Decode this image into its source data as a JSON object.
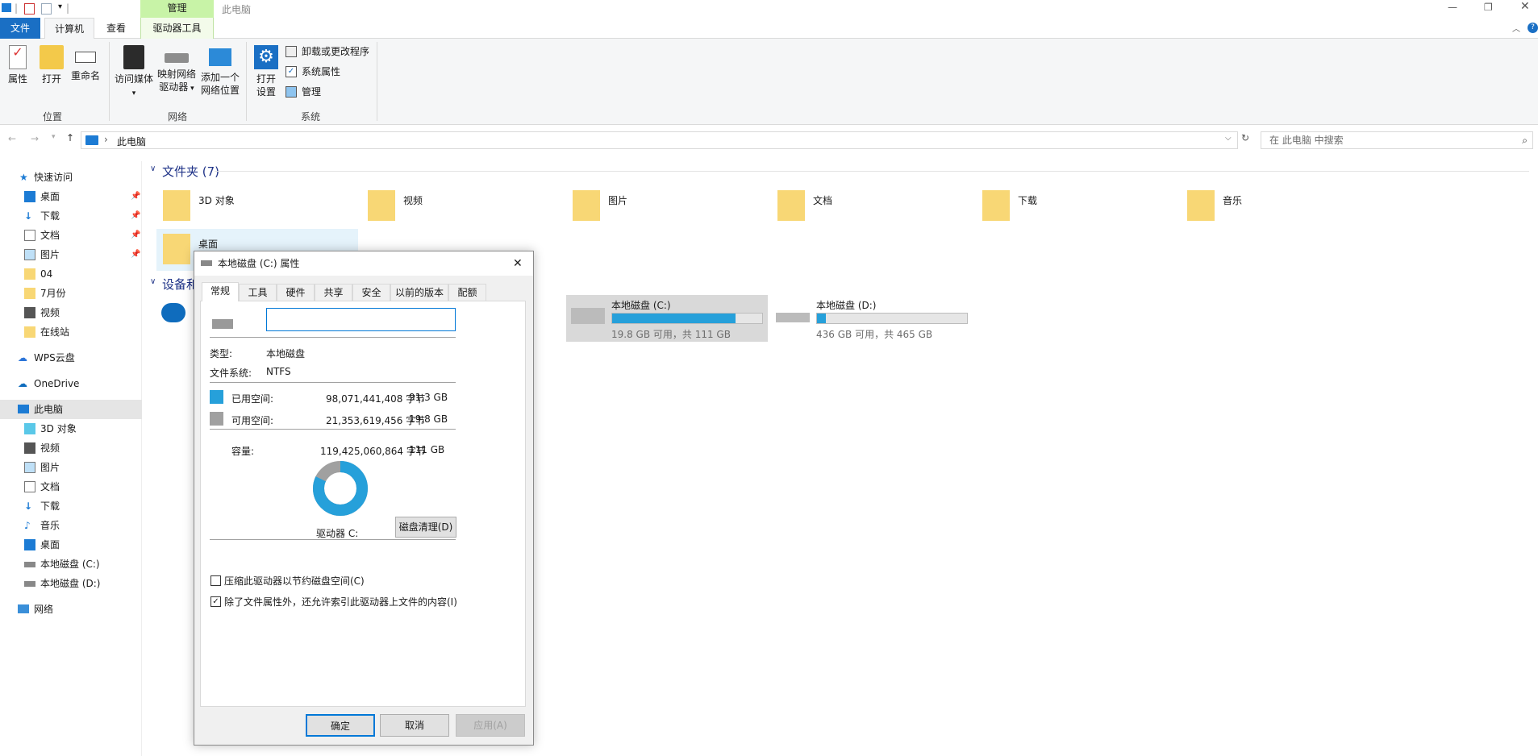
{
  "window": {
    "title": "此电脑",
    "manage_tab": "管理"
  },
  "tabs": [
    "文件",
    "计算机",
    "查看",
    "驱动器工具"
  ],
  "ribbon": {
    "location": {
      "label": "位置",
      "buttons": [
        "属性",
        "打开",
        "重命名"
      ]
    },
    "network": {
      "label": "网络",
      "access_media": "访问媒体",
      "map_drive_1": "映射网络",
      "map_drive_2": "驱动器",
      "add_location_1": "添加一个",
      "add_location_2": "网络位置"
    },
    "system": {
      "label": "系统",
      "open_settings_1": "打开",
      "open_settings_2": "设置",
      "uninstall": "卸载或更改程序",
      "sys_props": "系统属性",
      "manage": "管理"
    }
  },
  "address": {
    "path": "此电脑",
    "search_placeholder": "在 此电脑 中搜索"
  },
  "nav": {
    "quick_access": "快速访问",
    "quick_items": [
      {
        "label": "桌面",
        "pinned": true
      },
      {
        "label": "下载",
        "pinned": true
      },
      {
        "label": "文档",
        "pinned": true
      },
      {
        "label": "图片",
        "pinned": true
      },
      {
        "label": "04"
      },
      {
        "label": "7月份"
      },
      {
        "label": "视频"
      },
      {
        "label": "在线站"
      }
    ],
    "wps": "WPS云盘",
    "onedrive": "OneDrive",
    "this_pc": "此电脑",
    "pc_items": [
      "3D 对象",
      "视频",
      "图片",
      "文档",
      "下载",
      "音乐",
      "桌面",
      "本地磁盘 (C:)",
      "本地磁盘 (D:)"
    ],
    "network": "网络"
  },
  "content": {
    "folders_header": "文件夹 (7)",
    "folders": [
      "3D 对象",
      "视频",
      "图片",
      "文档",
      "下载",
      "音乐",
      "桌面"
    ],
    "devices_header": "设备和",
    "drives": [
      {
        "name": "本地磁盘 (C:)",
        "info": "19.8 GB 可用，共 111 GB",
        "used_fraction": 0.82
      },
      {
        "name": "本地磁盘 (D:)",
        "info": "436 GB 可用，共 465 GB",
        "used_fraction": 0.06
      }
    ]
  },
  "dialog": {
    "title": "本地磁盘 (C:) 属性",
    "tabs": [
      "常规",
      "工具",
      "硬件",
      "共享",
      "安全",
      "以前的版本",
      "配额"
    ],
    "name_value": "",
    "type_label": "类型:",
    "type_value": "本地磁盘",
    "fs_label": "文件系统:",
    "fs_value": "NTFS",
    "used_label": "已用空间:",
    "used_bytes": "98,071,441,408 字节",
    "used_size": "91.3 GB",
    "free_label": "可用空间:",
    "free_bytes": "21,353,619,456 字节",
    "free_size": "19.8 GB",
    "cap_label": "容量:",
    "cap_bytes": "119,425,060,864 字节",
    "cap_size": "111 GB",
    "drive_label": "驱动器 C:",
    "cleanup": "磁盘清理(D)",
    "compress": "压缩此驱动器以节约磁盘空间(C)",
    "index": "除了文件属性外，还允许索引此驱动器上文件的内容(I)",
    "used_fraction": 0.821,
    "ok": "确定",
    "cancel": "取消",
    "apply": "应用(A)",
    "colors": {
      "used": "#26a0da",
      "free": "#a0a0a0"
    }
  }
}
